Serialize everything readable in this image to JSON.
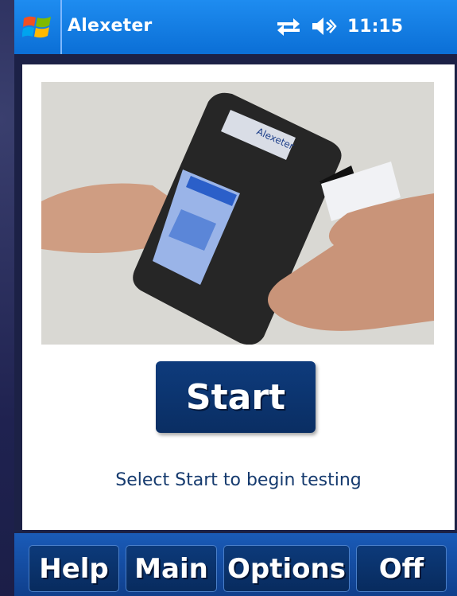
{
  "titlebar": {
    "app_title": "Alexeter",
    "time": "11:15",
    "icons": [
      "windows-start-icon",
      "connectivity-icon",
      "speaker-muted-icon"
    ]
  },
  "main": {
    "image_label": "Alexeter",
    "start_label": "Start",
    "instruction": "Select Start to begin testing"
  },
  "menu": {
    "items": [
      {
        "label": "Help"
      },
      {
        "label": "Main"
      },
      {
        "label": "Options"
      },
      {
        "label": "Off"
      }
    ]
  },
  "colors": {
    "titlebar": "#0b6fd6",
    "button_bg": "#0e3b7c",
    "instruction_text": "#153a6e",
    "menubar": "#1a5bb8"
  }
}
